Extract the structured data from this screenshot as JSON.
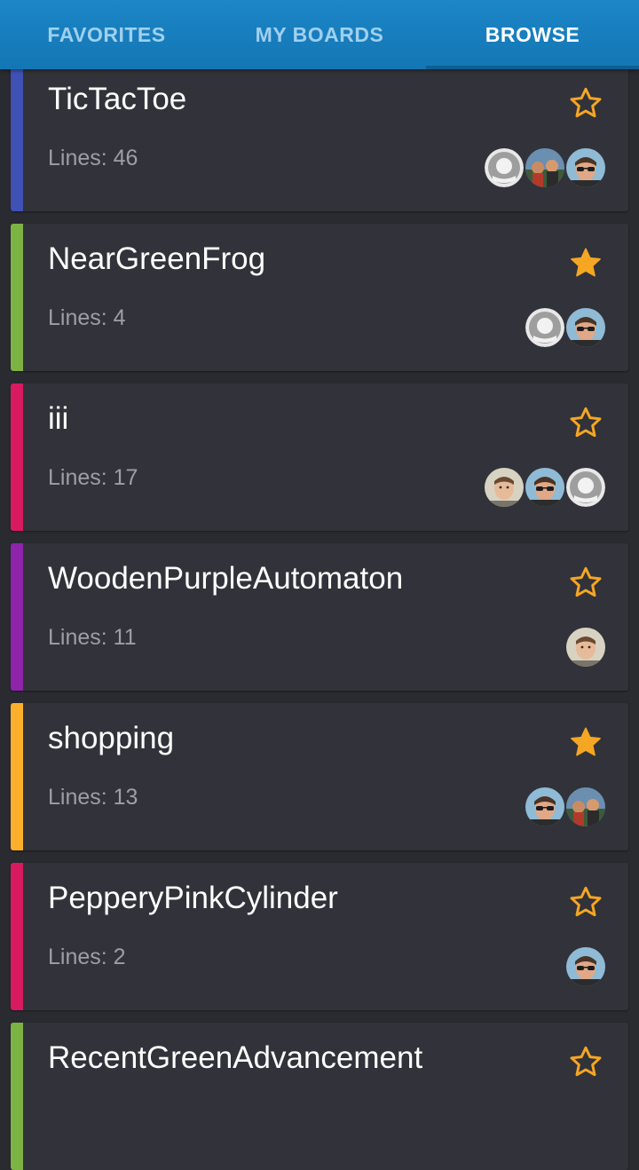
{
  "tabs": [
    {
      "label": "FAVORITES",
      "active": false
    },
    {
      "label": "MY BOARDS",
      "active": false
    },
    {
      "label": "BROWSE",
      "active": true
    }
  ],
  "colors": {
    "accent_star": "#f5a623",
    "tabbar": "#1a80c0",
    "card_bg": "#32323a"
  },
  "boards": [
    {
      "title": "TicTacToe",
      "lines": "Lines: 46",
      "color": "#3f51b5",
      "favorite": false,
      "avatars": [
        "placeholder-avatar",
        "group-photo-avatar",
        "man-sunglasses-avatar"
      ]
    },
    {
      "title": "NearGreenFrog",
      "lines": "Lines: 4",
      "color": "#7cb342",
      "favorite": true,
      "avatars": [
        "placeholder-avatar",
        "man-sunglasses-avatar"
      ]
    },
    {
      "title": "iii",
      "lines": "Lines: 17",
      "color": "#d81b60",
      "favorite": false,
      "avatars": [
        "man-portrait-avatar",
        "man-sunglasses-avatar",
        "placeholder-avatar"
      ]
    },
    {
      "title": "WoodenPurpleAutomaton",
      "lines": "Lines: 11",
      "color": "#8e24aa",
      "favorite": false,
      "avatars": [
        "man-portrait-avatar"
      ]
    },
    {
      "title": "shopping",
      "lines": "Lines: 13",
      "color": "#fbb02d",
      "favorite": true,
      "avatars": [
        "man-sunglasses-avatar",
        "group-photo-avatar"
      ]
    },
    {
      "title": "PepperyPinkCylinder",
      "lines": "Lines: 2",
      "color": "#d81b60",
      "favorite": false,
      "avatars": [
        "man-sunglasses-avatar"
      ]
    },
    {
      "title": "RecentGreenAdvancement",
      "lines": "",
      "color": "#7cb342",
      "favorite": false,
      "avatars": []
    }
  ]
}
